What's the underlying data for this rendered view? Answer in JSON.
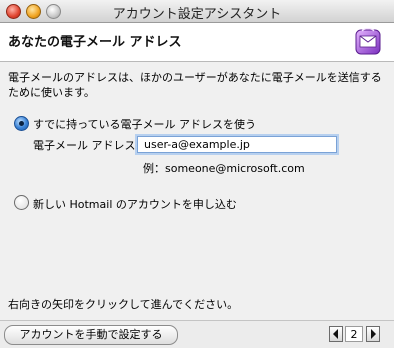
{
  "window": {
    "title": "アカウント設定アシスタント"
  },
  "header": {
    "heading": "あなたの電子メール アドレス"
  },
  "main": {
    "intro": "電子メールのアドレスは、ほかのユーザーがあなたに電子メールを送信するために使います。",
    "option_existing": "すでに持っている電子メール アドレスを使う",
    "email_label": "電子メール アドレス",
    "email_value": "user-a@example.jp",
    "example": "例：someone@microsoft.com",
    "option_hotmail": "新しい Hotmail のアカウントを申し込む",
    "instruction": "右向きの矢印をクリックして進んでください。"
  },
  "footer": {
    "manual_button": "アカウントを手動で設定する",
    "page_number": "2"
  },
  "icons": {
    "app": "entourage-icon",
    "back": "back-arrow-icon",
    "forward": "forward-arrow-icon"
  },
  "colors": {
    "accent_blue": "#3b83d6",
    "field_focus": "#7aa2d6"
  }
}
